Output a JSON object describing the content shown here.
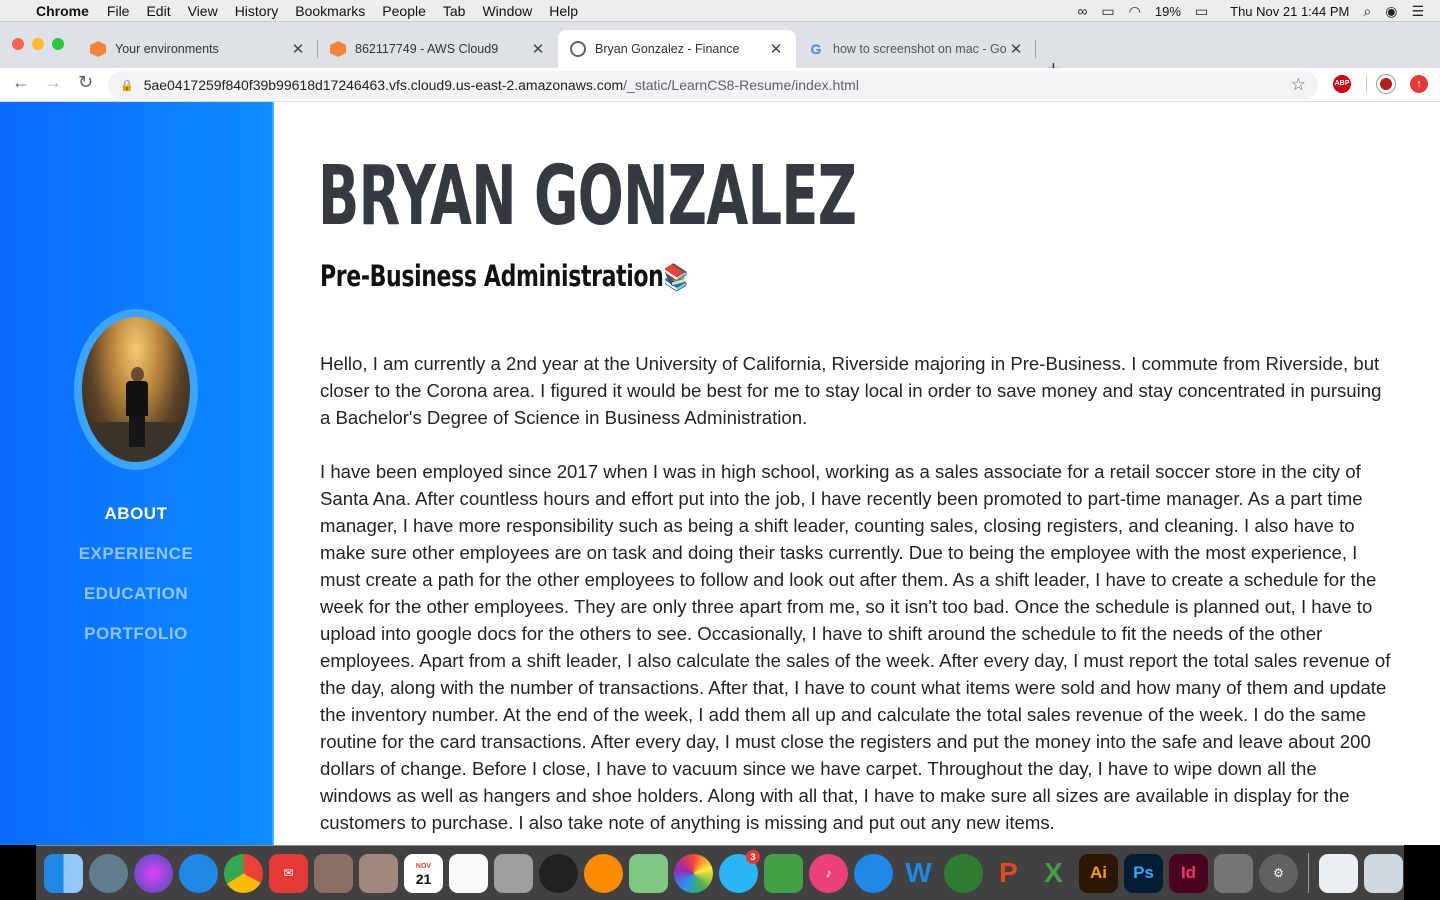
{
  "menubar": {
    "app": "Chrome",
    "items": [
      "File",
      "Edit",
      "View",
      "History",
      "Bookmarks",
      "People",
      "Tab",
      "Window",
      "Help"
    ],
    "battery": "19%",
    "clock": "Thu Nov 21  1:44 PM"
  },
  "tabs": [
    {
      "title": "Your environments",
      "icon": "aws-cube-icon",
      "active": false
    },
    {
      "title": "862117749 - AWS Cloud9",
      "icon": "aws-cube-icon",
      "active": false
    },
    {
      "title": "Bryan Gonzalez - Finance",
      "icon": "globe-icon",
      "active": true
    },
    {
      "title": "how to screenshot on mac - Go",
      "icon": "google-icon",
      "active": false
    }
  ],
  "address": {
    "host": "5ae0417259f840f39b99618d17246463.vfs.cloud9.us-east-2.amazonaws.com",
    "path": "/_static/LearnCS8-Resume/index.html"
  },
  "extensions": {
    "adblock": "ABP"
  },
  "sidebar": {
    "nav": [
      {
        "label": "ABOUT",
        "active": true
      },
      {
        "label": "EXPERIENCE",
        "active": false
      },
      {
        "label": "EDUCATION",
        "active": false
      },
      {
        "label": "PORTFOLIO",
        "active": false
      }
    ]
  },
  "resume": {
    "name": "BRYAN GONZALEZ",
    "subtitle": "Pre-Business Administration",
    "subtitle_emoji": "📚",
    "paragraph1": "Hello, I am currently a 2nd year at the University of California, Riverside majoring in Pre-Business. I commute from Riverside, but closer to the Corona area. I figured it would be best for me to stay local in order to save money and stay concentrated in pursuing a Bachelor's Degree of Science in Business Administration.",
    "paragraph2": "I have been employed since 2017 when I was in high school, working as a sales associate for a retail soccer store in the city of Santa Ana. After countless hours and effort put into the job, I have recently been promoted to part-time manager. As a part time manager, I have more responsibility such as being a shift leader, counting sales, closing registers, and cleaning. I also have to make sure other employees are on task and doing their tasks currently. Due to being the employee with the most experience, I must create a path for the other employees to follow and look out after them. As a shift leader, I have to create a schedule for the week for the other employees. They are only three apart from me, so it isn't too bad. Once the schedule is planned out, I have to upload into google docs for the others to see. Occasionally, I have to shift around the schedule to fit the needs of the other employees. Apart from a shift leader, I also calculate the sales of the week. After every day, I must report the total sales revenue of the day, along with the number of transactions. After that, I have to count what items were sold and how many of them and update the inventory number. At the end of the week, I add them all up and calculate the total sales revenue of the week. I do the same routine for the card transactions. After every day, I must close the registers and put the money into the safe and leave about 200 dollars of change. Before I close, I have to vacuum since we have carpet. Throughout the day, I have to wipe down all the windows as well as hangers and shoe holders. Along with all that, I have to make sure all sizes are available in display for the customers to purchase. I also take note of anything is missing and put out any new items."
  },
  "dock": {
    "calendar_month": "NOV",
    "calendar_day": "21",
    "messages_badge": "3",
    "labels": {
      "word": "W",
      "excel": "X",
      "illustrator": "Ai",
      "photoshop": "Ps",
      "indesign": "Id"
    }
  },
  "colors": {
    "sidebar_start": "#0a6bff",
    "sidebar_end": "#0d8cff",
    "heading": "#343a40",
    "body_text": "#212529"
  }
}
